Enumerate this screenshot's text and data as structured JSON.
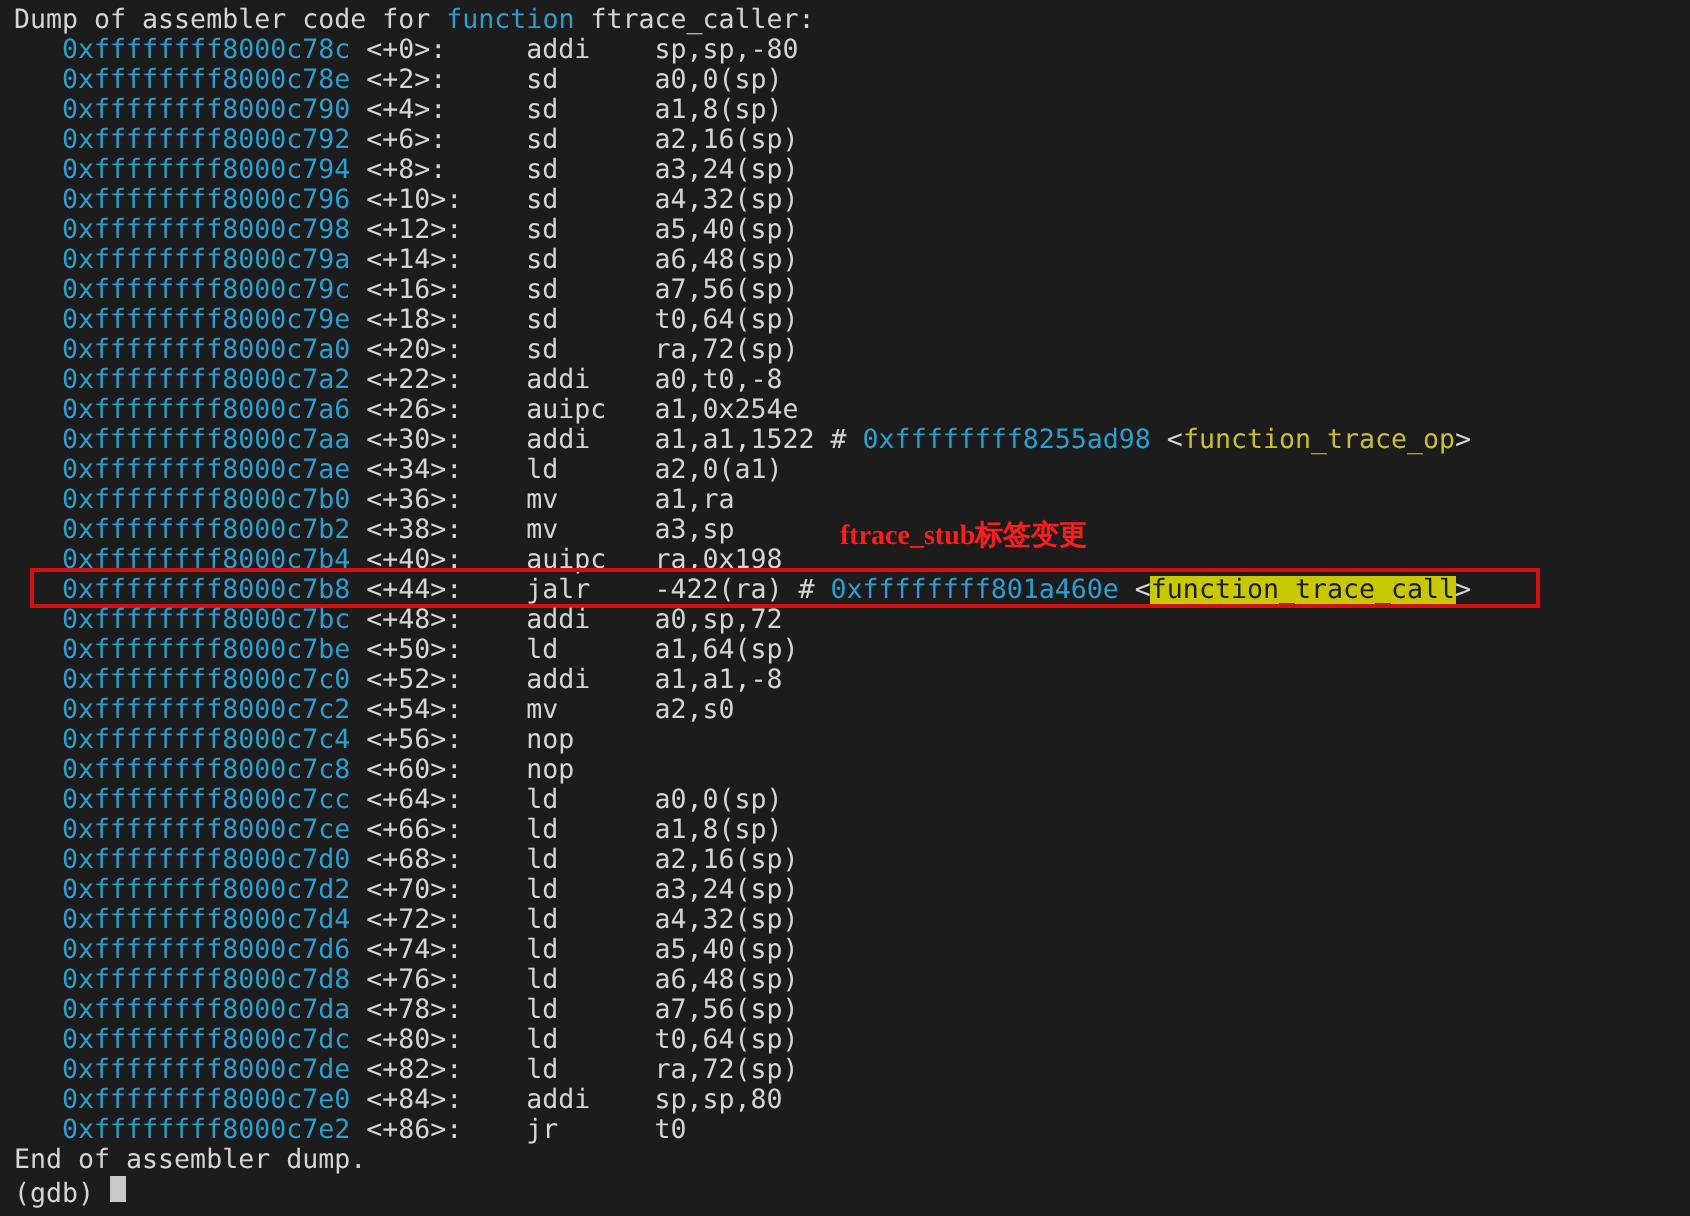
{
  "header": {
    "before": "Dump of assembler code for",
    "keyword": "function",
    "after": "ftrace_caller:"
  },
  "rows": [
    {
      "address": "0xffffffff8000c78c",
      "offset": "<+0>:",
      "mnemonic": "addi",
      "operands": "sp,sp,-80"
    },
    {
      "address": "0xffffffff8000c78e",
      "offset": "<+2>:",
      "mnemonic": "sd",
      "operands": "a0,0(sp)"
    },
    {
      "address": "0xffffffff8000c790",
      "offset": "<+4>:",
      "mnemonic": "sd",
      "operands": "a1,8(sp)"
    },
    {
      "address": "0xffffffff8000c792",
      "offset": "<+6>:",
      "mnemonic": "sd",
      "operands": "a2,16(sp)"
    },
    {
      "address": "0xffffffff8000c794",
      "offset": "<+8>:",
      "mnemonic": "sd",
      "operands": "a3,24(sp)"
    },
    {
      "address": "0xffffffff8000c796",
      "offset": "<+10>:",
      "mnemonic": "sd",
      "operands": "a4,32(sp)"
    },
    {
      "address": "0xffffffff8000c798",
      "offset": "<+12>:",
      "mnemonic": "sd",
      "operands": "a5,40(sp)"
    },
    {
      "address": "0xffffffff8000c79a",
      "offset": "<+14>:",
      "mnemonic": "sd",
      "operands": "a6,48(sp)"
    },
    {
      "address": "0xffffffff8000c79c",
      "offset": "<+16>:",
      "mnemonic": "sd",
      "operands": "a7,56(sp)"
    },
    {
      "address": "0xffffffff8000c79e",
      "offset": "<+18>:",
      "mnemonic": "sd",
      "operands": "t0,64(sp)"
    },
    {
      "address": "0xffffffff8000c7a0",
      "offset": "<+20>:",
      "mnemonic": "sd",
      "operands": "ra,72(sp)"
    },
    {
      "address": "0xffffffff8000c7a2",
      "offset": "<+22>:",
      "mnemonic": "addi",
      "operands": "a0,t0,-8"
    },
    {
      "address": "0xffffffff8000c7a6",
      "offset": "<+26>:",
      "mnemonic": "auipc",
      "operands": "a1,0x254e"
    },
    {
      "address": "0xffffffff8000c7aa",
      "offset": "<+30>:",
      "mnemonic": "addi",
      "operands": "a1,a1,1522",
      "comment": {
        "marker": "#",
        "target": "0xffffffff8255ad98",
        "open": "<",
        "symbol": "function_trace_op",
        "close": ">",
        "highlighted": false
      }
    },
    {
      "address": "0xffffffff8000c7ae",
      "offset": "<+34>:",
      "mnemonic": "ld",
      "operands": "a2,0(a1)"
    },
    {
      "address": "0xffffffff8000c7b0",
      "offset": "<+36>:",
      "mnemonic": "mv",
      "operands": "a1,ra"
    },
    {
      "address": "0xffffffff8000c7b2",
      "offset": "<+38>:",
      "mnemonic": "mv",
      "operands": "a3,sp"
    },
    {
      "address": "0xffffffff8000c7b4",
      "offset": "<+40>:",
      "mnemonic": "auipc",
      "operands": "ra,0x198"
    },
    {
      "address": "0xffffffff8000c7b8",
      "offset": "<+44>:",
      "mnemonic": "jalr",
      "operands": "-422(ra)",
      "comment": {
        "marker": "#",
        "target": "0xffffffff801a460e",
        "open": "<",
        "symbol": "function_trace_call",
        "close": ">",
        "highlighted": true
      },
      "boxed": true,
      "annotation": "ftrace_stub标签变更"
    },
    {
      "address": "0xffffffff8000c7bc",
      "offset": "<+48>:",
      "mnemonic": "addi",
      "operands": "a0,sp,72"
    },
    {
      "address": "0xffffffff8000c7be",
      "offset": "<+50>:",
      "mnemonic": "ld",
      "operands": "a1,64(sp)"
    },
    {
      "address": "0xffffffff8000c7c0",
      "offset": "<+52>:",
      "mnemonic": "addi",
      "operands": "a1,a1,-8"
    },
    {
      "address": "0xffffffff8000c7c2",
      "offset": "<+54>:",
      "mnemonic": "mv",
      "operands": "a2,s0"
    },
    {
      "address": "0xffffffff8000c7c4",
      "offset": "<+56>:",
      "mnemonic": "nop"
    },
    {
      "address": "0xffffffff8000c7c8",
      "offset": "<+60>:",
      "mnemonic": "nop"
    },
    {
      "address": "0xffffffff8000c7cc",
      "offset": "<+64>:",
      "mnemonic": "ld",
      "operands": "a0,0(sp)"
    },
    {
      "address": "0xffffffff8000c7ce",
      "offset": "<+66>:",
      "mnemonic": "ld",
      "operands": "a1,8(sp)"
    },
    {
      "address": "0xffffffff8000c7d0",
      "offset": "<+68>:",
      "mnemonic": "ld",
      "operands": "a2,16(sp)"
    },
    {
      "address": "0xffffffff8000c7d2",
      "offset": "<+70>:",
      "mnemonic": "ld",
      "operands": "a3,24(sp)"
    },
    {
      "address": "0xffffffff8000c7d4",
      "offset": "<+72>:",
      "mnemonic": "ld",
      "operands": "a4,32(sp)"
    },
    {
      "address": "0xffffffff8000c7d6",
      "offset": "<+74>:",
      "mnemonic": "ld",
      "operands": "a5,40(sp)"
    },
    {
      "address": "0xffffffff8000c7d8",
      "offset": "<+76>:",
      "mnemonic": "ld",
      "operands": "a6,48(sp)"
    },
    {
      "address": "0xffffffff8000c7da",
      "offset": "<+78>:",
      "mnemonic": "ld",
      "operands": "a7,56(sp)"
    },
    {
      "address": "0xffffffff8000c7dc",
      "offset": "<+80>:",
      "mnemonic": "ld",
      "operands": "t0,64(sp)"
    },
    {
      "address": "0xffffffff8000c7de",
      "offset": "<+82>:",
      "mnemonic": "ld",
      "operands": "ra,72(sp)"
    },
    {
      "address": "0xffffffff8000c7e0",
      "offset": "<+84>:",
      "mnemonic": "addi",
      "operands": "sp,sp,80"
    },
    {
      "address": "0xffffffff8000c7e2",
      "offset": "<+86>:",
      "mnemonic": "jr",
      "operands": "t0"
    }
  ],
  "footer": "End of assembler dump.",
  "prompt": "(gdb)"
}
